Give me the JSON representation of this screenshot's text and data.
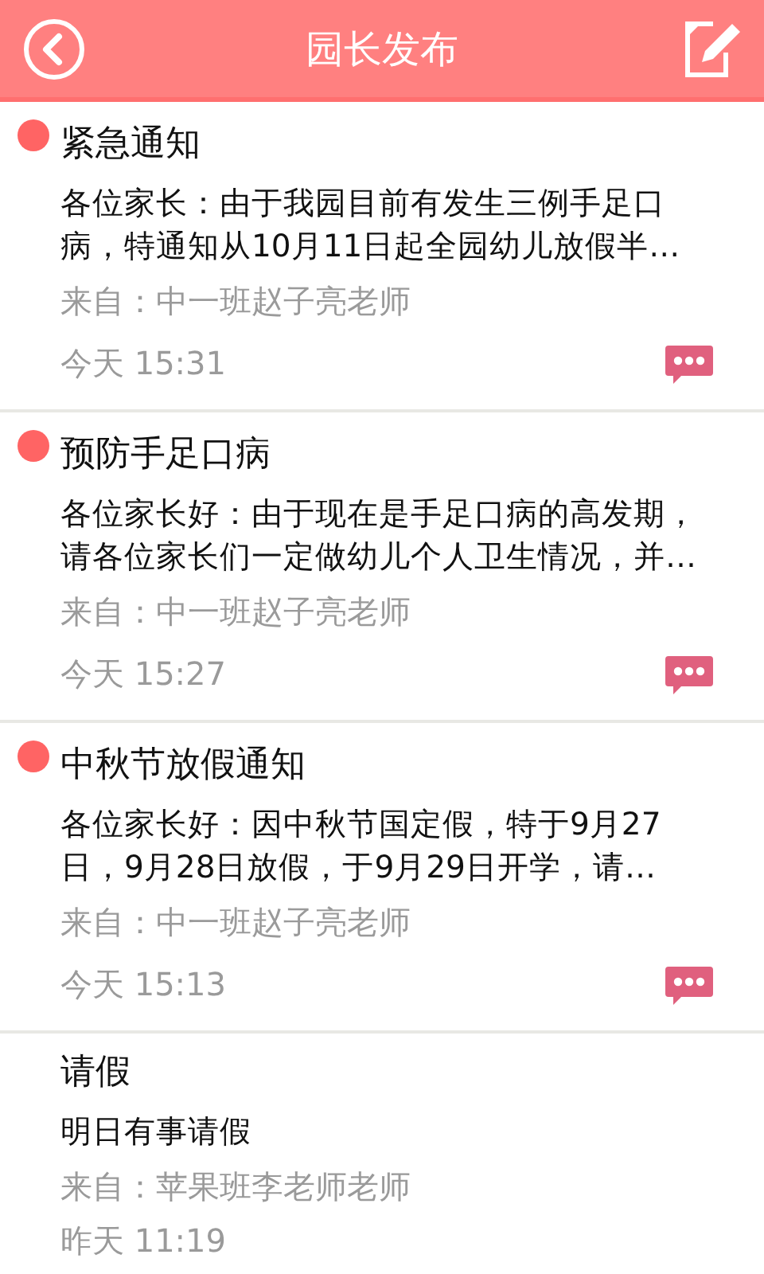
{
  "header": {
    "title": "园长发布"
  },
  "posts": [
    {
      "title": "紧急通知",
      "unread": true,
      "body": "各位家长：由于我园目前有发生三例手足口病，特通知从10月11日起全园幼儿放假半…",
      "from": "来自：中一班赵子亮老师",
      "time": "今天 15:31",
      "has_comments": true
    },
    {
      "title": "预防手足口病",
      "unread": true,
      "body": "各位家长好：由于现在是手足口病的高发期，请各位家长们一定做幼儿个人卫生情况，并…",
      "from": "来自：中一班赵子亮老师",
      "time": "今天 15:27",
      "has_comments": true
    },
    {
      "title": "中秋节放假通知",
      "unread": true,
      "body": "各位家长好：因中秋节国定假，特于9月27日，9月28日放假，于9月29日开学，请…",
      "from": "来自：中一班赵子亮老师",
      "time": "今天 15:13",
      "has_comments": true
    },
    {
      "title": "请假",
      "unread": false,
      "body": "明日有事请假",
      "from": "来自：苹果班李老师老师",
      "time": "昨天 11:19",
      "has_comments": false
    }
  ]
}
